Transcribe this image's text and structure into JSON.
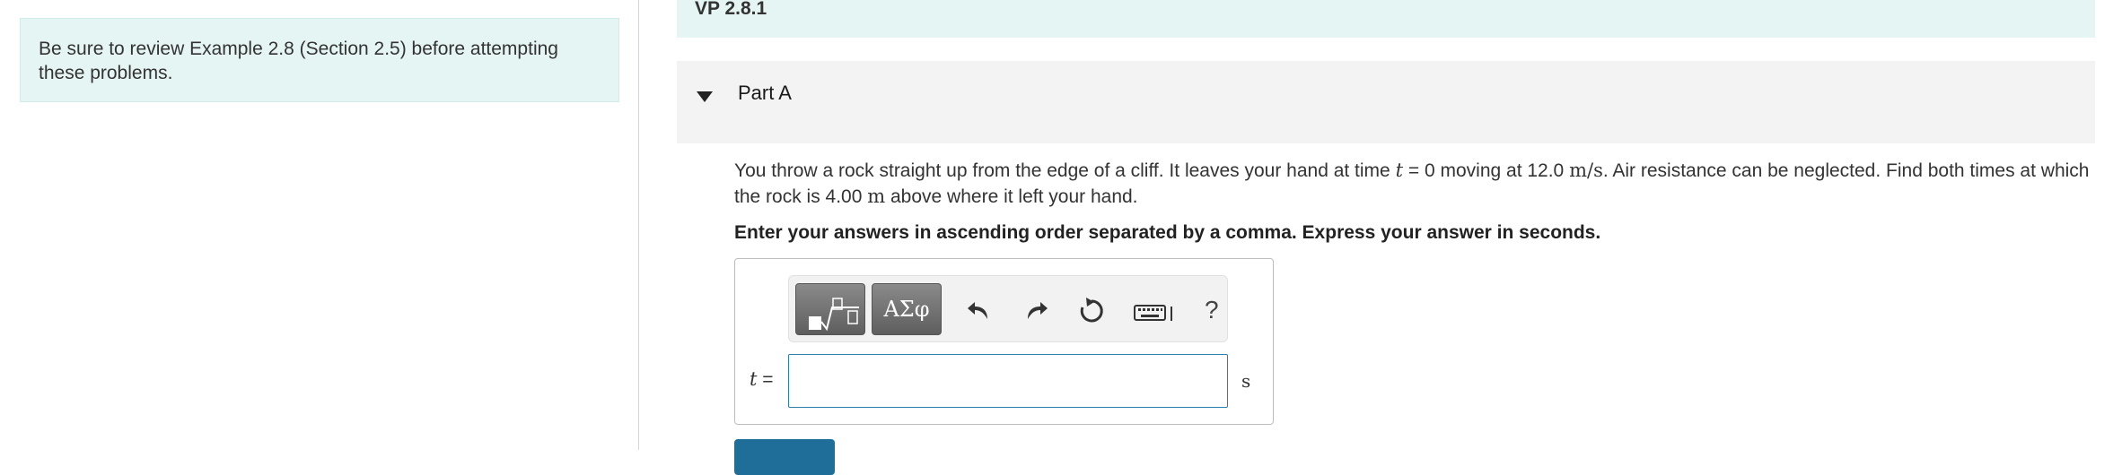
{
  "sidebar": {
    "intro_text": "Be sure to review Example 2.8 (Section 2.5) before attempting these problems."
  },
  "problem_set": {
    "title": "VP 2.8.1"
  },
  "part": {
    "title": "Part A",
    "question": {
      "segment_1": "You throw a rock straight up from the edge of a cliff. It leaves your hand at time ",
      "var_t": "t",
      "segment_2": " = 0 moving at 12.0 ",
      "unit_ms": "m/s",
      "segment_3": ". Air resistance can be neglected. Find both times at which the rock is 4.00 ",
      "unit_m": "m",
      "segment_4": " above where it left your hand."
    },
    "instruction": "Enter your answers in ascending order separated by a comma. Express your answer in seconds."
  },
  "answer": {
    "variable": "t",
    "equals": "=",
    "value": "",
    "unit": "s",
    "toolbar": {
      "symbols_label": "ΑΣφ",
      "help_label": "?"
    }
  },
  "colors": {
    "info_background": "#e5f5f4",
    "part_header_background": "#f3f3f3",
    "input_border": "#2e7fa8",
    "submit_button": "#1f6e99"
  }
}
